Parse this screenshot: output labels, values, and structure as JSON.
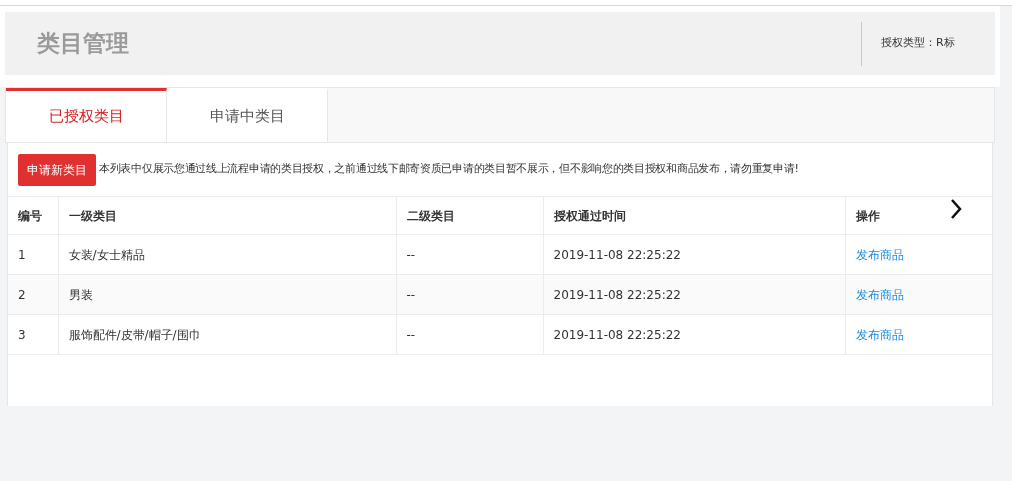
{
  "header": {
    "title": "类目管理",
    "auth_type": "授权类型：R标"
  },
  "tabs": [
    {
      "label": "已授权类目",
      "selected": true
    },
    {
      "label": "申请中类目",
      "selected": false
    }
  ],
  "apply_button": "申请新类目",
  "notice": "本列表中仅展示您通过线上流程申请的类目授权，之前通过线下邮寄资质已申请的类目暂不展示，但不影响您的类目授权和商品发布，请勿重复申请!",
  "table": {
    "columns": [
      "编号",
      "一级类目",
      "二级类目",
      "授权通过时间",
      "操作"
    ],
    "rows": [
      {
        "cells": [
          "1",
          "女装/女士精品",
          "--",
          "2019-11-08 22:25:22"
        ],
        "action": "发布商品"
      },
      {
        "cells": [
          "2",
          "男装",
          "--",
          "2019-11-08 22:25:22"
        ],
        "action": "发布商品"
      },
      {
        "cells": [
          "3",
          "服饰配件/皮带/帽子/围巾",
          "--",
          "2019-11-08 22:25:22"
        ],
        "action": "发布商品"
      }
    ]
  }
}
